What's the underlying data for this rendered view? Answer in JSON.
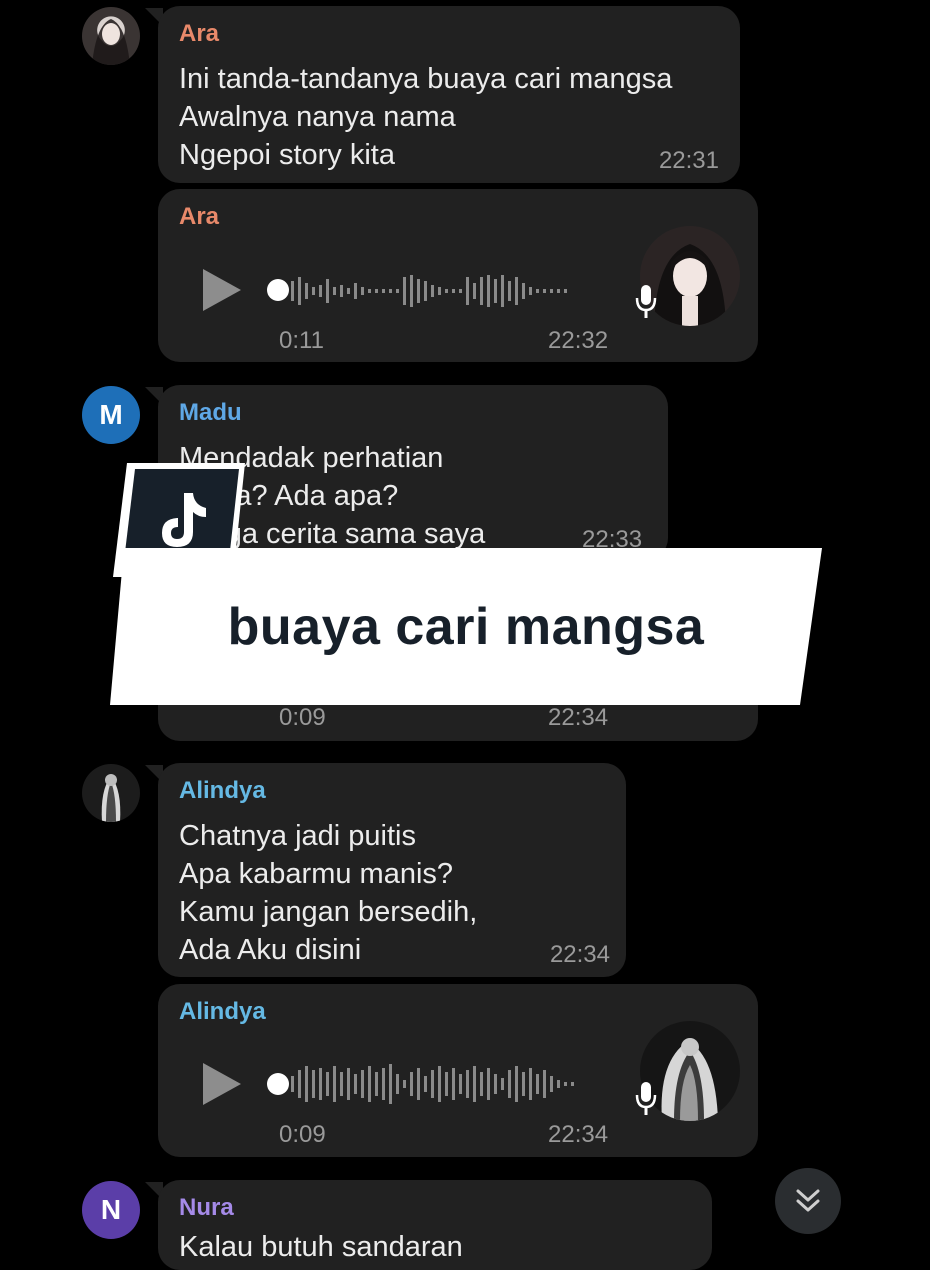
{
  "messages": [
    {
      "sender": "Ara",
      "lines": [
        "Ini tanda-tandanya buaya cari mangsa",
        "Awalnya nanya nama",
        "Ngepoi story kita"
      ],
      "time": "22:31"
    },
    {
      "sender": "Ara",
      "type": "voice",
      "duration": "0:11",
      "time": "22:32"
    },
    {
      "sender": "Madu",
      "avatar_letter": "M",
      "lines": [
        "Mendadak perhatian",
        "...apa? Ada apa?",
        "...lega cerita sama saya"
      ],
      "time": "22:33"
    },
    {
      "type": "voice",
      "duration": "0:09",
      "time": "22:34"
    },
    {
      "sender": "Alindya",
      "lines": [
        "Chatnya jadi puitis",
        "Apa kabarmu manis?",
        "Kamu jangan bersedih,",
        "Ada Aku disini"
      ],
      "time": "22:34"
    },
    {
      "sender": "Alindya",
      "type": "voice",
      "duration": "0:09",
      "time": "22:34"
    },
    {
      "sender": "Nura",
      "avatar_letter": "N",
      "lines": [
        "Kalau butuh sandaran"
      ]
    }
  ],
  "overlay": {
    "caption": "buaya cari mangsa",
    "logo": "tiktok-logo-icon"
  },
  "colors": {
    "ara": "#e8896a",
    "madu": "#5fa8e6",
    "alindya": "#65b9e4",
    "nura": "#a58ae8",
    "madu_avatar": "#1e6fb8",
    "nura_avatar": "#5b3ea8",
    "bubble": "#212121"
  },
  "icons": {
    "scroll": "chevron-double-down-icon",
    "play": "play-icon",
    "mic": "microphone-icon"
  }
}
